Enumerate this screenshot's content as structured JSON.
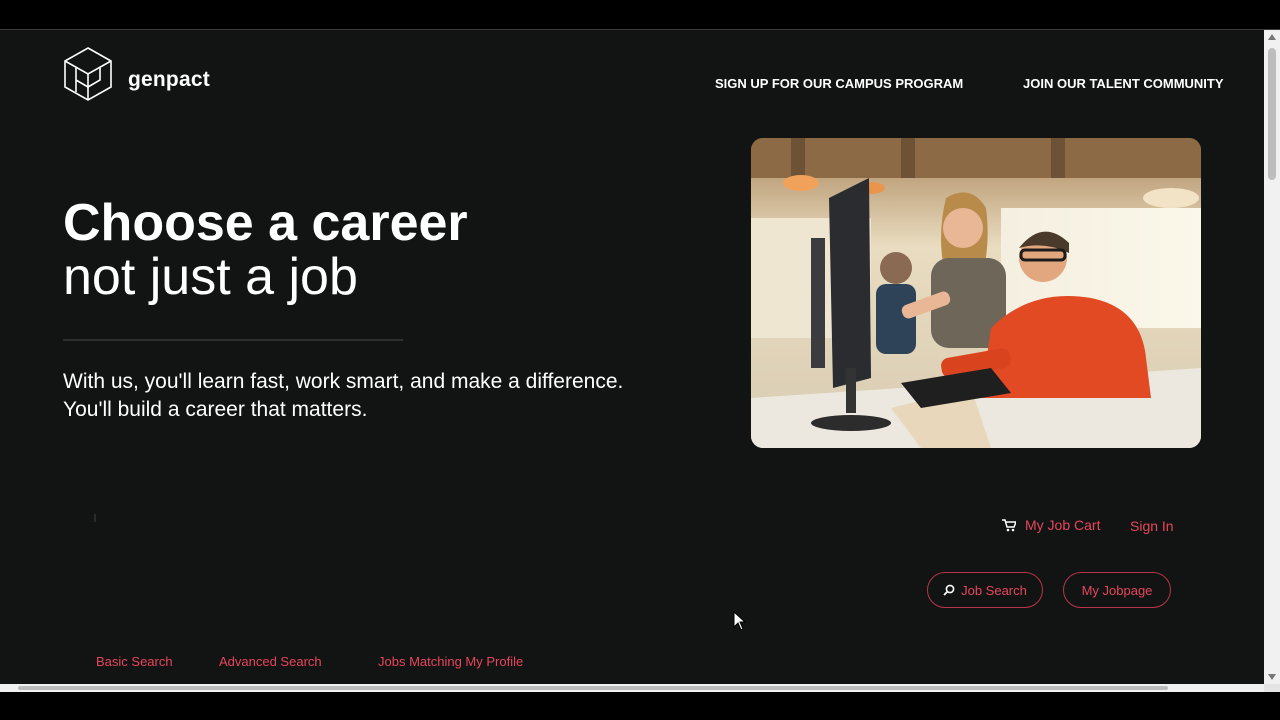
{
  "brand": {
    "name": "genpact",
    "accent": "#e8455e"
  },
  "header": {
    "nav": [
      {
        "label": "SIGN UP FOR OUR CAMPUS PROGRAM"
      },
      {
        "label": "JOIN OUR TALENT COMMUNITY"
      }
    ]
  },
  "hero": {
    "title_line1": "Choose a career",
    "title_line2": "not just a job",
    "subtitle": "With us, you'll learn fast, work smart, and make a difference. You'll build a career that matters."
  },
  "account": {
    "cart_icon": "shopping-cart-icon",
    "cart_label": "My Job Cart",
    "signin_label": "Sign In"
  },
  "actions": {
    "search_icon": "search-icon",
    "job_search_label": "Job Search",
    "my_jobpage_label": "My Jobpage"
  },
  "search_tabs": [
    {
      "label": "Basic Search"
    },
    {
      "label": "Advanced Search"
    },
    {
      "label": "Jobs Matching My Profile"
    }
  ]
}
